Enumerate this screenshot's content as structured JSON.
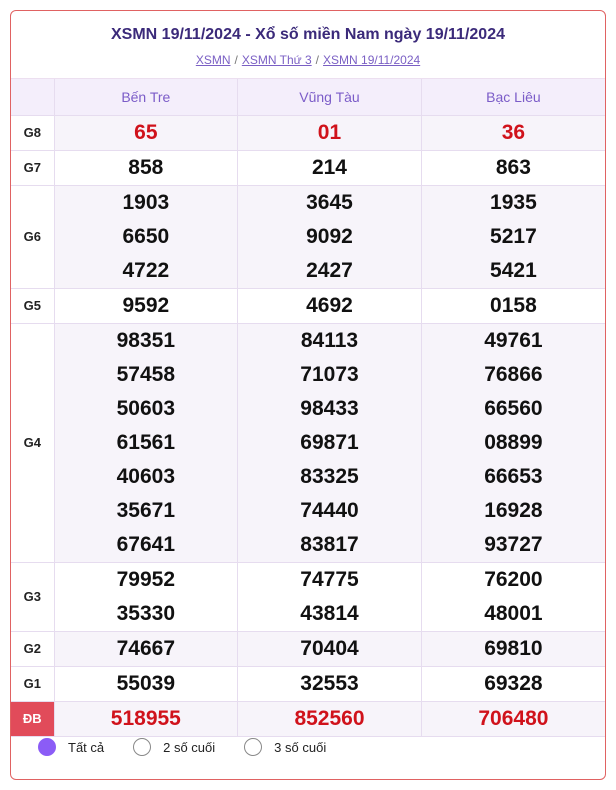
{
  "header": {
    "title": "XSMN 19/11/2024 - Xổ số miền Nam ngày 19/11/2024",
    "breadcrumb": [
      "XSMN",
      "XSMN Thứ 3",
      "XSMN 19/11/2024"
    ],
    "separator": "/"
  },
  "table": {
    "columns": [
      "Bến Tre",
      "Vũng Tàu",
      "Bạc Liêu"
    ],
    "prizes": [
      {
        "label": "G8",
        "rows": [
          [
            "65",
            "01",
            "36"
          ]
        ],
        "highlight": true
      },
      {
        "label": "G7",
        "rows": [
          [
            "858",
            "214",
            "863"
          ]
        ]
      },
      {
        "label": "G6",
        "rows": [
          [
            "1903",
            "3645",
            "1935"
          ],
          [
            "6650",
            "9092",
            "5217"
          ],
          [
            "4722",
            "2427",
            "5421"
          ]
        ]
      },
      {
        "label": "G5",
        "rows": [
          [
            "9592",
            "4692",
            "0158"
          ]
        ]
      },
      {
        "label": "G4",
        "rows": [
          [
            "98351",
            "84113",
            "49761"
          ],
          [
            "57458",
            "71073",
            "76866"
          ],
          [
            "50603",
            "98433",
            "66560"
          ],
          [
            "61561",
            "69871",
            "08899"
          ],
          [
            "40603",
            "83325",
            "66653"
          ],
          [
            "35671",
            "74440",
            "16928"
          ],
          [
            "67641",
            "83817",
            "93727"
          ]
        ]
      },
      {
        "label": "G3",
        "rows": [
          [
            "79952",
            "74775",
            "76200"
          ],
          [
            "35330",
            "43814",
            "48001"
          ]
        ]
      },
      {
        "label": "G2",
        "rows": [
          [
            "74667",
            "70404",
            "69810"
          ]
        ]
      },
      {
        "label": "G1",
        "rows": [
          [
            "55039",
            "32553",
            "69328"
          ]
        ]
      },
      {
        "label": "ĐB",
        "rows": [
          [
            "518955",
            "852560",
            "706480"
          ]
        ],
        "highlight": true,
        "special": true
      }
    ]
  },
  "filters": {
    "options": [
      "Tất cả",
      "2 số cuối",
      "3 số cuối"
    ],
    "selected": "Tất cả"
  },
  "colors": {
    "accent": "#8b5cf6",
    "highlight_number": "#d0121b",
    "special_label_bg": "#e14b5a",
    "border": "#e06262"
  }
}
